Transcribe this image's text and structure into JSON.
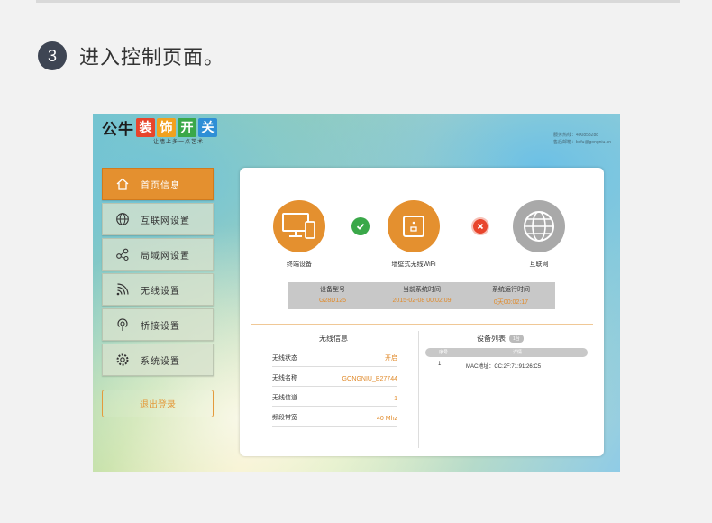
{
  "step": {
    "number": "3",
    "text": "进入控制页面。"
  },
  "header": {
    "logo_plain": "公牛",
    "logo_chars": [
      {
        "char": "装",
        "color": "#e8452c"
      },
      {
        "char": "饰",
        "color": "#f2a11f"
      },
      {
        "char": "开",
        "color": "#3aa849"
      },
      {
        "char": "关",
        "color": "#2f8fd6"
      }
    ],
    "tagline": "让墙上多一点艺术",
    "contact_line1": "服务热线：400853288",
    "contact_line2": "售后邮箱：bxfu@gongniu.cn"
  },
  "sidebar": {
    "items": [
      {
        "label": "首页信息",
        "icon": "home-icon",
        "active": true
      },
      {
        "label": "互联网设置",
        "icon": "globe-icon",
        "active": false
      },
      {
        "label": "局域网设置",
        "icon": "share-icon",
        "active": false
      },
      {
        "label": "无线设置",
        "icon": "wifi-icon",
        "active": false
      },
      {
        "label": "桥接设置",
        "icon": "bridge-icon",
        "active": false
      },
      {
        "label": "系统设置",
        "icon": "gear-icon",
        "active": false
      }
    ],
    "logout": "退出登录"
  },
  "topology": {
    "terminal": "终端设备",
    "router": "墙壁式无线WiFi",
    "internet": "互联网",
    "status_ok": "check-icon",
    "status_err": "cross-icon"
  },
  "info": {
    "model_label": "设备型号",
    "model_value": "G28D125",
    "time_label": "当前系统时间",
    "time_value": "2015-02-08 00:02:09",
    "uptime_label": "系统运行时间",
    "uptime_value": "0天00:02:17"
  },
  "wireless": {
    "title": "无线信息",
    "rows": [
      {
        "key": "无线状态",
        "value": "开启"
      },
      {
        "key": "无线名称",
        "value": "GONGNIU_B27744"
      },
      {
        "key": "无线信道",
        "value": "1"
      },
      {
        "key": "频段带宽",
        "value": "40 Mhz"
      }
    ]
  },
  "device_list": {
    "title": "设备列表",
    "count": "1台",
    "col_index": "序号",
    "col_detail": "详情",
    "rows": [
      {
        "index": "1",
        "detail": "MAC地址：CC:2F:71:91:26:C5"
      }
    ]
  },
  "colors": {
    "accent": "#e4902f",
    "value_text": "#e08a2a",
    "ok": "#3aa849",
    "err": "#e8452c"
  }
}
